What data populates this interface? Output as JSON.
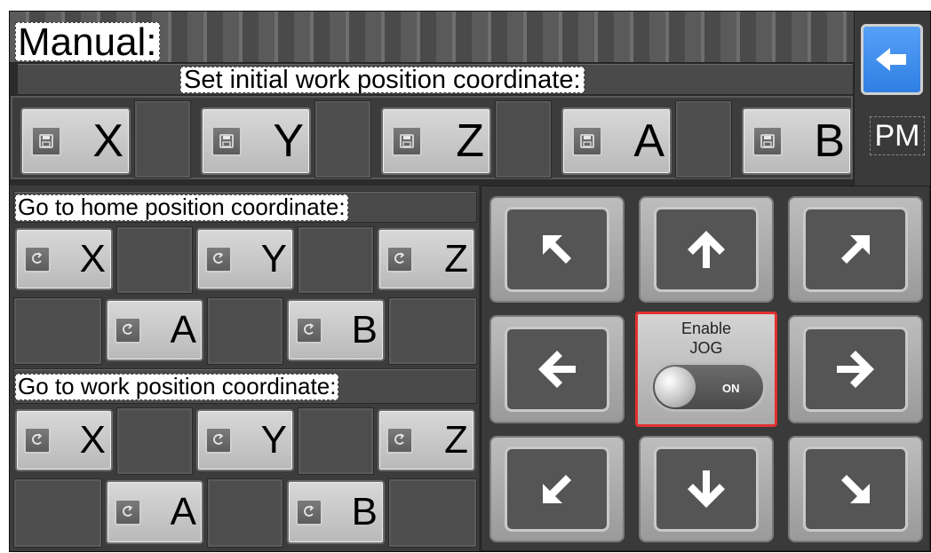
{
  "manual_title": "Manual:",
  "set_initial_label": "Set initial work position coordinate:",
  "set_buttons": [
    "X",
    "Y",
    "Z",
    "A",
    "B"
  ],
  "pm_label": "PM",
  "home_label": "Go to home position coordinate:",
  "home_buttons": [
    "X",
    "Y",
    "Z",
    "A",
    "B"
  ],
  "work_label": "Go to work position coordinate:",
  "work_buttons": [
    "X",
    "Y",
    "Z",
    "A",
    "B"
  ],
  "jog": {
    "enable_line1": "Enable",
    "enable_line2": "JOG",
    "toggle_state": "ON"
  },
  "colors": {
    "accent_back": "#2f7fe3",
    "jog_border": "#e23030"
  },
  "icons": {
    "save": "floppy-disk-icon",
    "goto": "return-arrow-icon",
    "back": "back-arrow-icon"
  }
}
